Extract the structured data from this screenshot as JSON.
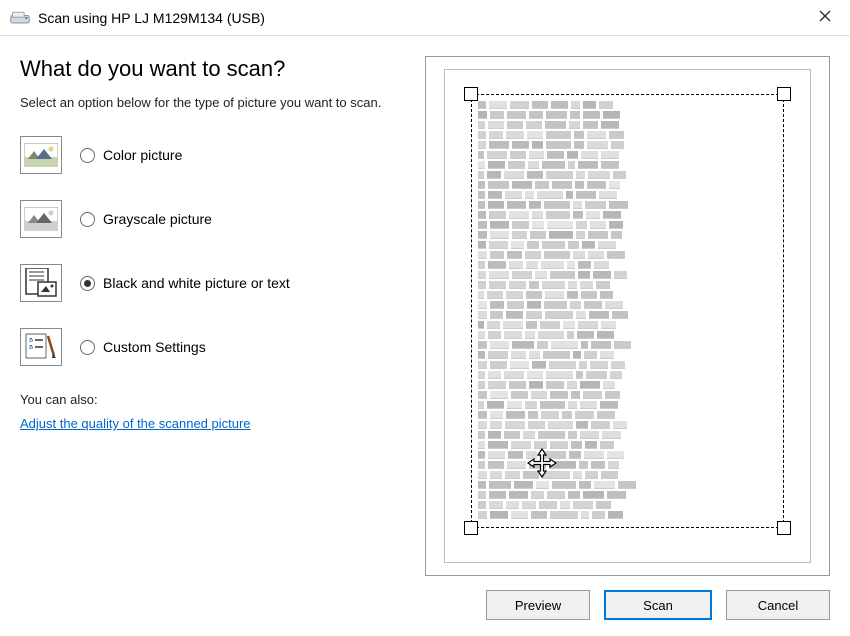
{
  "window": {
    "title": "Scan using HP LJ M129M134 (USB)"
  },
  "heading": "What do you want to scan?",
  "subheading": "Select an option below for the type of picture you want to scan.",
  "options": [
    {
      "label": "Color picture",
      "selected": false
    },
    {
      "label": "Grayscale picture",
      "selected": false
    },
    {
      "label": "Black and white picture or text",
      "selected": true
    },
    {
      "label": "Custom Settings",
      "selected": false
    }
  ],
  "also_text": "You can also:",
  "adjust_link": "Adjust the quality of the scanned picture",
  "buttons": {
    "preview": "Preview",
    "scan": "Scan",
    "cancel": "Cancel"
  }
}
